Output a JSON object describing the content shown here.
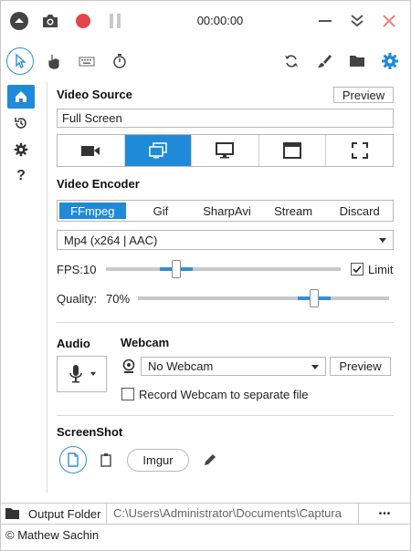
{
  "topbar": {
    "timer": "00:00:00",
    "icons": [
      "collapse-icon",
      "camera-icon",
      "record-icon",
      "pause-icon",
      "minimize-icon",
      "expand-down-icon",
      "close-icon"
    ]
  },
  "toolbar": {
    "tools": [
      "cursor-icon",
      "hand-icon",
      "keyboard-icon",
      "timer-icon"
    ],
    "right_tools": [
      "refresh-icon",
      "brush-icon",
      "folder-icon",
      "settings-icon"
    ]
  },
  "sidenav": {
    "items": [
      "home-icon",
      "history-icon",
      "settings-icon",
      "help-icon"
    ],
    "help_glyph": "?"
  },
  "video_source": {
    "title": "Video Source",
    "preview_label": "Preview",
    "value": "Full Screen",
    "tabs": [
      "webcam-source-icon",
      "screen-source-icon",
      "monitor-source-icon",
      "window-source-icon",
      "region-source-icon"
    ],
    "active_tab": 1
  },
  "video_encoder": {
    "title": "Video Encoder",
    "tabs": [
      "FFmpeg",
      "Gif",
      "SharpAvi",
      "Stream",
      "Discard"
    ],
    "active_tab": 0,
    "codec": "Mp4 (x264 | AAC)"
  },
  "fps": {
    "label": "FPS:",
    "value": "10",
    "limit_label": "Limit",
    "limit_checked": true,
    "slider_level": 0.3
  },
  "quality": {
    "label": "Quality:",
    "value": "70%",
    "slider_level": 0.7
  },
  "audio": {
    "title": "Audio"
  },
  "webcam": {
    "title": "Webcam",
    "selected": "No Webcam",
    "preview_label": "Preview",
    "separate_file_label": "Record Webcam to separate file",
    "separate_file_checked": false
  },
  "screenshot": {
    "title": "ScreenShot",
    "imgur_label": "Imgur"
  },
  "status": {
    "output_label": "Output Folder",
    "output_path": "C:\\Users\\Administrator\\Documents\\Captura",
    "more_label": "•••"
  },
  "footer": {
    "text": "© Mathew Sachin"
  },
  "colors": {
    "accent": "#1f8ad8",
    "record": "#e0474c",
    "close": "#f08080"
  }
}
